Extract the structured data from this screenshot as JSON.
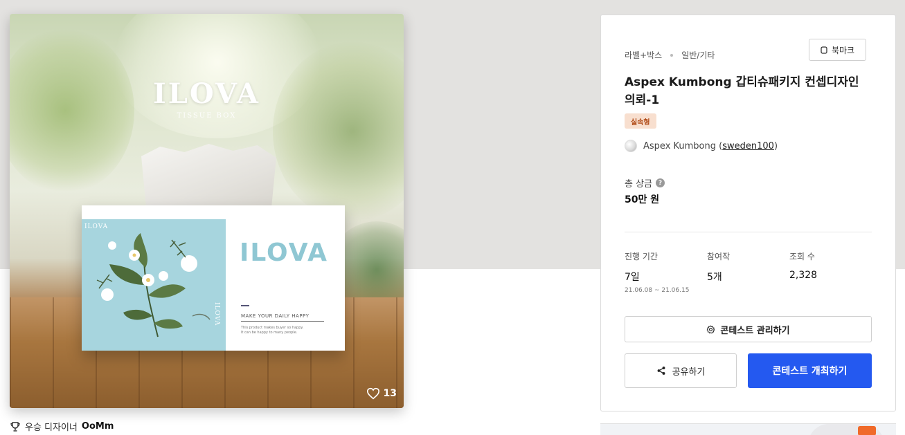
{
  "image_card": {
    "poster_title": "ILOVA",
    "poster_subtitle": "TISSUE BOX",
    "box_brand": "ILOVA",
    "box_panel_brand": "ILOVA",
    "box_panel_vertical": "ILOVA",
    "box_tagline": "MAKE YOUR DAILY HAPPY",
    "box_small_line1": "This product makes buyer so happy.",
    "box_small_line2": "It can be happy to many people.",
    "like_count": "13"
  },
  "winner": {
    "label": "우승 디자이너",
    "designer": "OoMm"
  },
  "info": {
    "category": "라벨+박스",
    "subcategory": "일반/기타",
    "bookmark_label": "북마크",
    "title": "Aspex Kumbong 갑티슈패키지 컨셉디자인 의뢰-1",
    "type_badge": "실속형",
    "host_name": "Aspex Kumbong",
    "host_id": "sweden100",
    "prize_label": "총 상금",
    "prize_value": "50만 원",
    "stats": [
      {
        "label": "진행 기간",
        "value": "7일",
        "sub": "21.06.08 ~ 21.06.15"
      },
      {
        "label": "참여작",
        "value": "5개"
      },
      {
        "label": "조회 수",
        "value": "2,328"
      }
    ],
    "manage_button": "콘테스트 관리하기",
    "share_button": "공유하기",
    "host_button": "콘테스트 개최하기"
  },
  "colors": {
    "primary": "#2459f0",
    "badge_bg": "#f8dfcf",
    "badge_text": "#b04a16",
    "box_panel": "#a7d5de"
  },
  "icons": [
    "heart-icon",
    "trophy-icon",
    "bookmark-icon",
    "help-icon",
    "gear-icon",
    "share-icon"
  ]
}
